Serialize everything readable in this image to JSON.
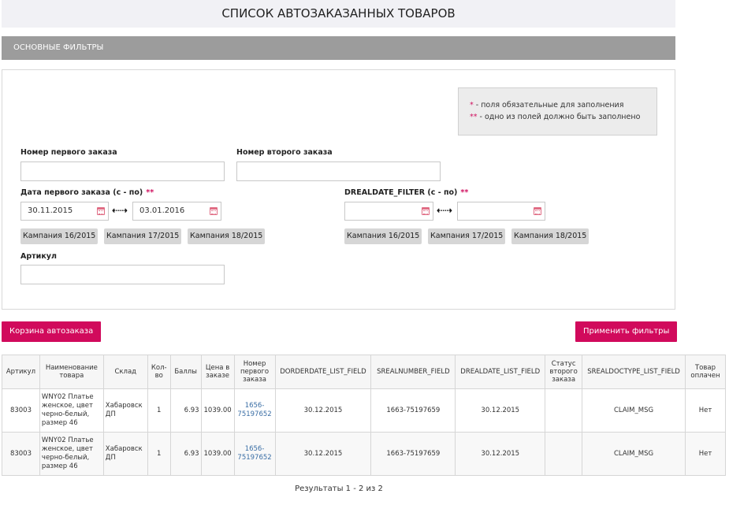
{
  "page_title": "СПИСОК АВТОЗАКАЗАННЫХ ТОВАРОВ",
  "filters": {
    "header": "ОСНОВНЫЕ ФИЛЬТРЫ",
    "legend": {
      "line1_star": "*",
      "line1_text": " - поля обязательные для заполнения",
      "line2_star": "**",
      "line2_text": " - одно из полей должно быть заполнено"
    },
    "first_order_label": "Номер первого заказа",
    "first_order_value": "",
    "second_order_label": "Номер второго заказа",
    "second_order_value": "",
    "first_date_label": "Дата первого заказа (с - по)",
    "first_date_req": "**",
    "first_date_from": "30.11.2015",
    "first_date_to": "03.01.2016",
    "second_date_label": "DREALDATE_FILTER (с - по)",
    "second_date_req": "**",
    "second_date_from": "",
    "second_date_to": "",
    "arrows": "⇠⇢",
    "presets_left": [
      "Кампания 16/2015",
      "Кампания 17/2015",
      "Кампания 18/2015"
    ],
    "presets_right": [
      "Кампания 16/2015",
      "Кампания 17/2015",
      "Кампания 18/2015"
    ],
    "article_label": "Артикул",
    "article_value": ""
  },
  "buttons": {
    "cart": "Корзина автозаказа",
    "apply": "Применить фильтры"
  },
  "table": {
    "headers": [
      "Артикул",
      "Наименование товара",
      "Склад",
      "Кол-во",
      "Баллы",
      "Цена в заказе",
      "Номер первого заказа",
      "DORDERDATE_LIST_FIELD",
      "SREALNUMBER_FIELD",
      "DREALDATE_LIST_FIELD",
      "Статус второго заказа",
      "SREALDOCTYPE_LIST_FIELD",
      "Товар оплачен"
    ],
    "rows": [
      {
        "article": "83003",
        "name": "WNY02 Платье женское, цвет черно-белый, размер 46",
        "warehouse": "Хабаровск ДП",
        "qty": "1",
        "points": "6.93",
        "price": "1039.00",
        "first_order": "1656-75197652",
        "orderdate": "30.12.2015",
        "realnumber": "1663-75197659",
        "realdate": "30.12.2015",
        "second_status": "",
        "doctype": "CLAIM_MSG",
        "paid": "Нет"
      },
      {
        "article": "83003",
        "name": "WNY02 Платье женское, цвет черно-белый, размер 46",
        "warehouse": "Хабаровск ДП",
        "qty": "1",
        "points": "6.93",
        "price": "1039.00",
        "first_order": "1656-75197652",
        "orderdate": "30.12.2015",
        "realnumber": "1663-75197659",
        "realdate": "30.12.2015",
        "second_status": "",
        "doctype": "CLAIM_MSG",
        "paid": "Нет"
      }
    ]
  },
  "pager": "Результаты 1 - 2 из 2",
  "colors": {
    "accent": "#d10a5c",
    "header_gray": "#9c9c9c"
  }
}
